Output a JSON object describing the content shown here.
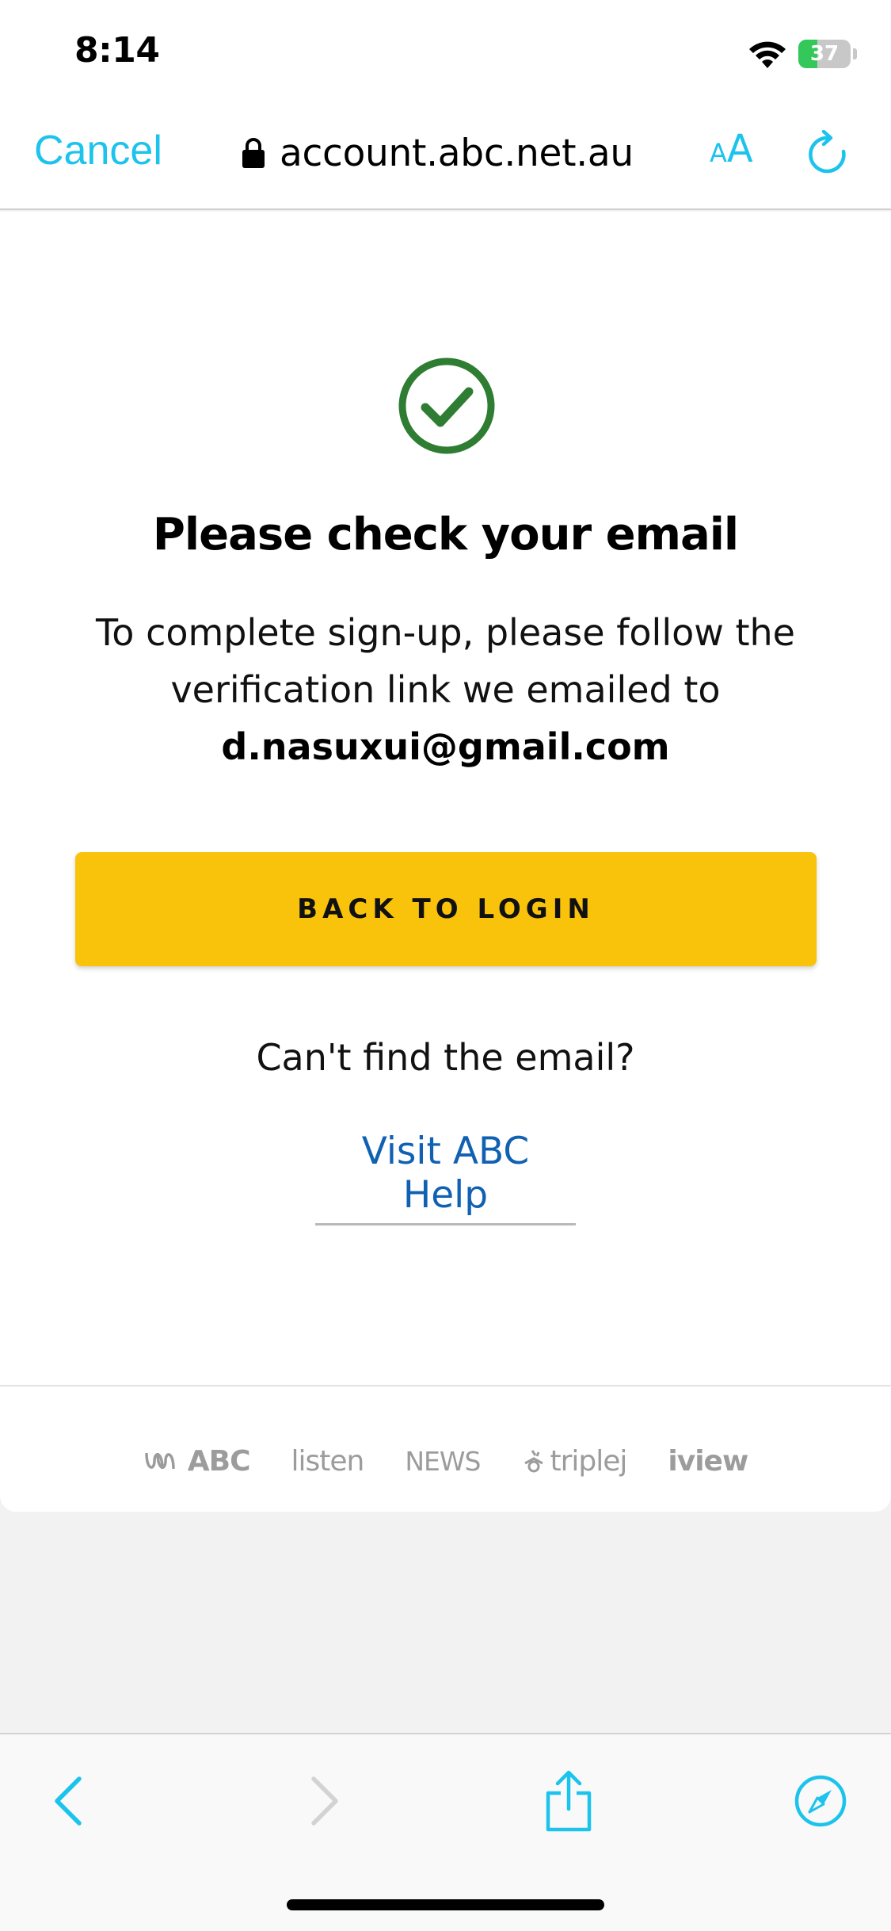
{
  "status_bar": {
    "time": "8:14",
    "battery_level": "37",
    "battery_fraction": 0.37,
    "battery_color": "#34c759",
    "icons": [
      "wifi-icon",
      "battery-icon"
    ]
  },
  "browser": {
    "cancel_label": "Cancel",
    "url": "account.abc.net.au",
    "text_size_small": "A",
    "text_size_big": "A",
    "accent_color": "#1cc3ec",
    "icons": [
      "lock-icon",
      "reload-icon"
    ]
  },
  "content": {
    "status_icon": "check-circle-icon",
    "success_color": "#2e7d32",
    "heading": "Please check your email",
    "message": "To complete sign-up, please follow the verification link we emailed to",
    "email": "d.nasuxui@gmail.com",
    "back_button_label": "BACK TO LOGIN",
    "button_color": "#f9c30b",
    "cant_find": "Can't find the email?",
    "help_link": "Visit ABC Help",
    "link_color": "#1161b3"
  },
  "footer": {
    "logos": {
      "abc": "ABC",
      "listen": "listen",
      "news": "NEWS",
      "triplej": "triplej",
      "iview": "iview"
    }
  },
  "toolbar": {
    "icons": [
      "back-icon",
      "forward-icon",
      "share-icon",
      "compass-icon"
    ],
    "forward_enabled": false
  }
}
